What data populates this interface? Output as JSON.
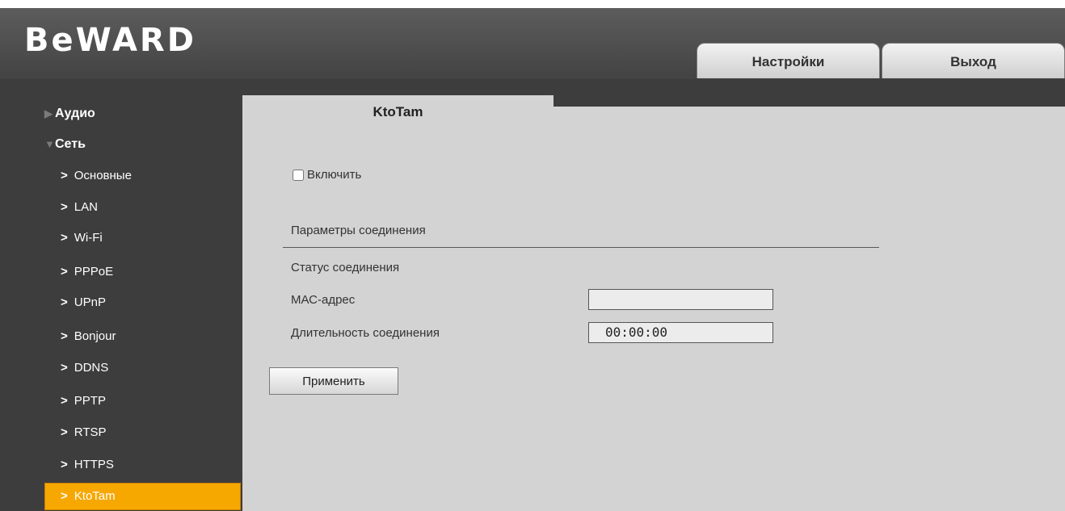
{
  "header": {
    "logo": "BeWARD",
    "tabs": [
      {
        "label": "Настройки"
      },
      {
        "label": "Выход"
      }
    ]
  },
  "sidebar": {
    "groups": [
      {
        "label": "Аудио",
        "expanded": false
      },
      {
        "label": "Сеть",
        "expanded": true
      }
    ],
    "items": [
      {
        "label": "Основные"
      },
      {
        "label": "LAN"
      },
      {
        "label": "Wi-Fi"
      },
      {
        "label": "PPPoE"
      },
      {
        "label": "UPnP"
      },
      {
        "label": "Bonjour"
      },
      {
        "label": "DDNS"
      },
      {
        "label": "PPTP"
      },
      {
        "label": "RTSP"
      },
      {
        "label": "HTTPS"
      },
      {
        "label": "KtoTam",
        "active": true
      }
    ]
  },
  "main": {
    "tab_title": "KtoTam",
    "enable_label": "Включить",
    "enable_checked": false,
    "section_title": "Параметры соединения",
    "status_label": "Статус соединения",
    "mac_label": "МАС-адрес",
    "mac_value": "",
    "duration_label": "Длительность соединения",
    "duration_value": "00:00:00",
    "apply_label": "Применить"
  },
  "colors": {
    "header_bg": "#4d4d4d",
    "sidebar_bg": "#3d3d3d",
    "content_bg": "#d3d3d3",
    "active_item": "#f6a800"
  }
}
